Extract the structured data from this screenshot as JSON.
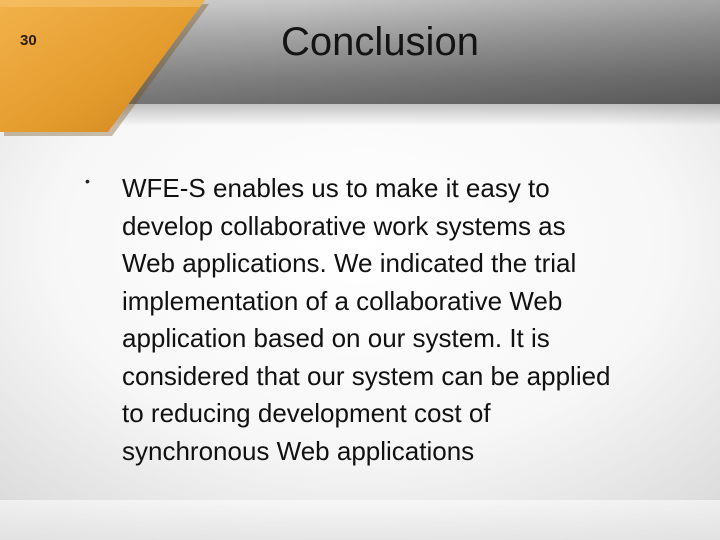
{
  "slide": {
    "number": "30",
    "title": "Conclusion",
    "bullets": [
      {
        "marker": "•",
        "text": "WFE-S enables us to make it easy to develop collaborative work systems as Web applications. We indicated the trial implementation of a collaborative Web application based on our system. It is considered that our system can be applied to reducing development cost of synchronous Web applications"
      }
    ]
  },
  "colors": {
    "accent_orange": "#e8a33c",
    "accent_orange_dark": "#c47a1a",
    "header_gray": "#8a8a8a",
    "text": "#111111"
  }
}
